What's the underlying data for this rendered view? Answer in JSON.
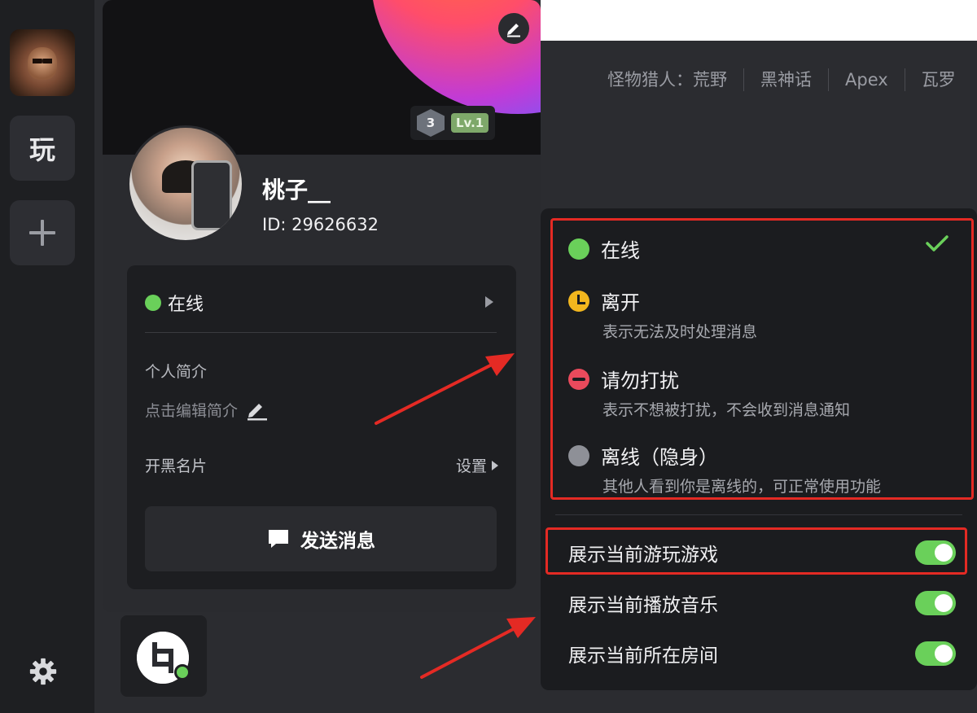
{
  "rail": {
    "play_label": "玩"
  },
  "header": {
    "tags": [
      "怪物猎人：荒野",
      "黑神话",
      "Apex",
      "瓦罗"
    ]
  },
  "profile": {
    "level_badge": "3",
    "level_label": "Lv.1",
    "name": "桃子__",
    "id_text": "ID: 29626632",
    "status_label": "在线",
    "intro_label": "个人简介",
    "intro_placeholder": "点击编辑简介",
    "card_label": "开黑名片",
    "card_setting": "设置",
    "send_button": "发送消息"
  },
  "status_menu": {
    "options": [
      {
        "label": "在线",
        "desc": "",
        "color": "#6ad05a",
        "selected": true
      },
      {
        "label": "离开",
        "desc": "表示无法及时处理消息",
        "color": "#f2b61e"
      },
      {
        "label": "请勿打扰",
        "desc": "表示不想被打扰，不会收到消息通知",
        "color": "#ea4a5c"
      },
      {
        "label": "离线（隐身）",
        "desc": "其他人看到你是离线的，可正常使用功能",
        "color": "#8e9097"
      }
    ],
    "toggles": [
      {
        "label": "展示当前游玩游戏",
        "on": true
      },
      {
        "label": "展示当前播放音乐",
        "on": true
      },
      {
        "label": "展示当前所在房间",
        "on": true
      }
    ]
  },
  "colors": {
    "online": "#6ad05a",
    "annotation": "#e42a24",
    "background": "#2b2c30"
  }
}
